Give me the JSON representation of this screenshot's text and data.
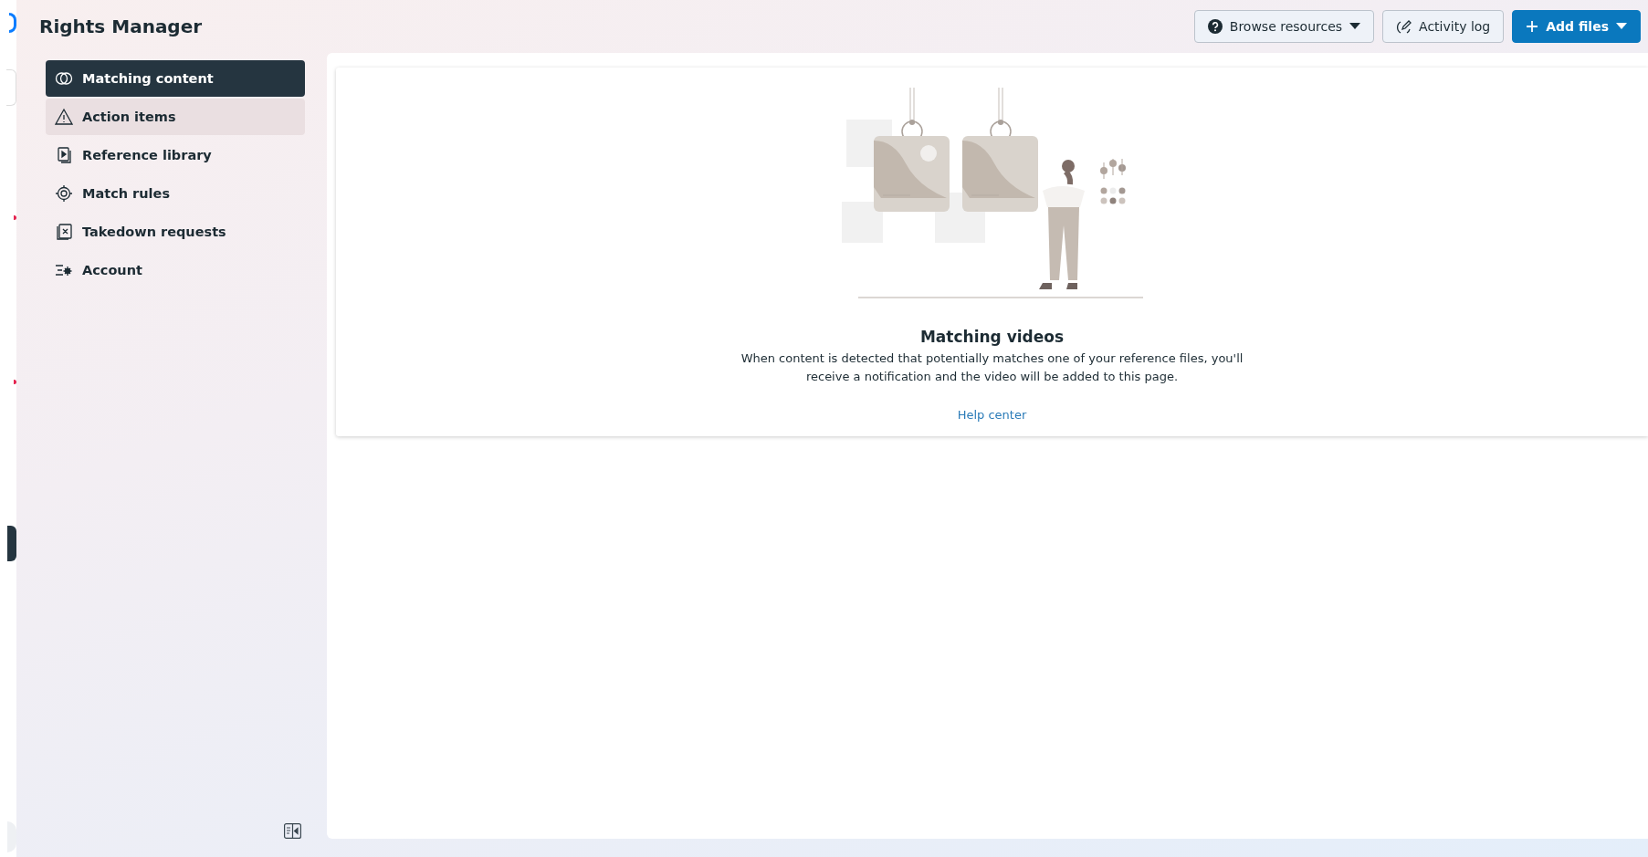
{
  "header": {
    "title": "Rights Manager",
    "buttons": [
      {
        "label": "Browse resources",
        "kind": "secondary",
        "menu": true
      },
      {
        "label": "Activity log",
        "kind": "secondary",
        "menu": false
      },
      {
        "label": "Add files",
        "kind": "primary",
        "menu": true
      }
    ]
  },
  "sidebar": {
    "items": [
      {
        "label": "Matching content",
        "selected": true,
        "highlighted": false
      },
      {
        "label": "Action items",
        "selected": false,
        "highlighted": true
      },
      {
        "label": "Reference library",
        "selected": false,
        "highlighted": false
      },
      {
        "label": "Match rules",
        "selected": false,
        "highlighted": false
      },
      {
        "label": "Takedown requests",
        "selected": false,
        "highlighted": false
      },
      {
        "label": "Account",
        "selected": false,
        "highlighted": false
      }
    ]
  },
  "empty_state": {
    "title": "Matching videos",
    "description": "When content is detected that potentially matches one of your reference files, you'll receive a notification and the video will be added to this page.",
    "link": "Help center"
  }
}
